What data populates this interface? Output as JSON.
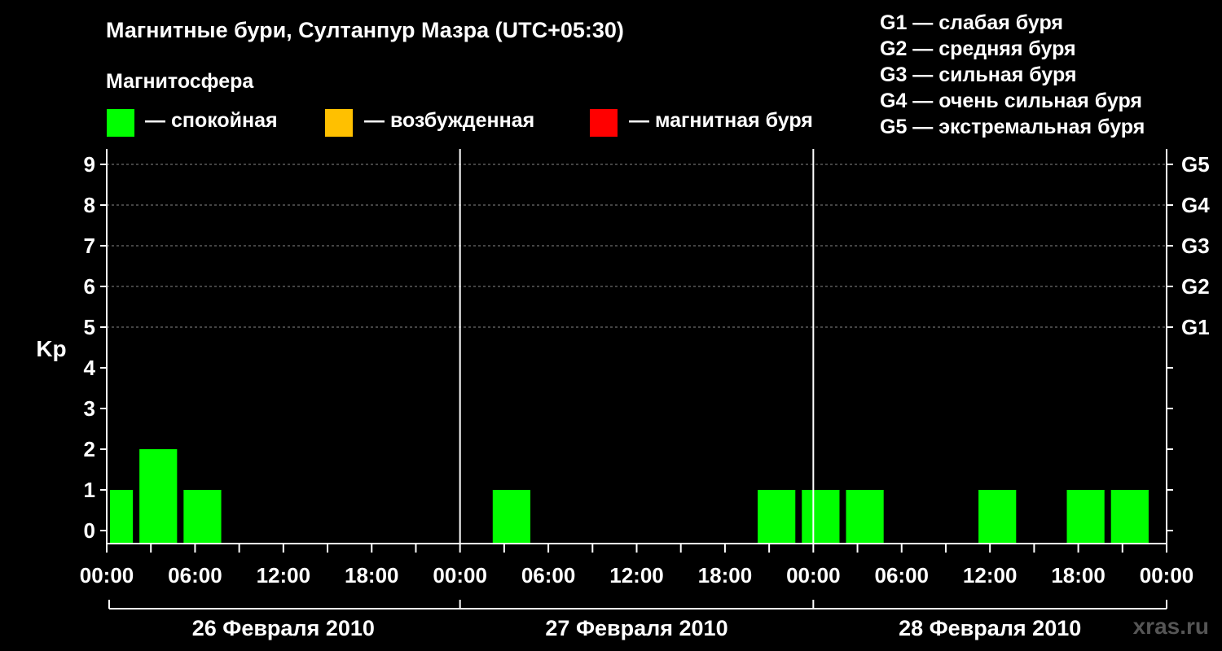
{
  "title": "Магнитные бури, Султанпур Мазра (UTC+05:30)",
  "magnetosphere": {
    "heading": "Магнитосфера",
    "legend": [
      {
        "label": "— спокойная",
        "color": "#00ff00"
      },
      {
        "label": "— возбужденная",
        "color": "#ffc000"
      },
      {
        "label": "— магнитная буря",
        "color": "#ff0000"
      }
    ]
  },
  "storm_scale": [
    "G1 — слабая буря",
    "G2 — средняя буря",
    "G3 — сильная буря",
    "G4 — очень сильная буря",
    "G5 — экстремальная буря"
  ],
  "watermark": "xras.ru",
  "colors": {
    "background": "#000000",
    "quiet": "#00ff00",
    "axis": "#ffffff",
    "grid": "#888888"
  },
  "chart_data": {
    "type": "bar",
    "ylabel": "Kp",
    "ylim": [
      0,
      9
    ],
    "y_ticks": [
      "0",
      "1",
      "2",
      "3",
      "4",
      "5",
      "6",
      "7",
      "8",
      "9"
    ],
    "right_ticks": [
      {
        "kp": 5,
        "label": "G1"
      },
      {
        "kp": 6,
        "label": "G2"
      },
      {
        "kp": 7,
        "label": "G3"
      },
      {
        "kp": 8,
        "label": "G4"
      },
      {
        "kp": 9,
        "label": "G5"
      }
    ],
    "x_tick_labels": [
      "00:00",
      "06:00",
      "12:00",
      "18:00",
      "00:00",
      "06:00",
      "12:00",
      "18:00",
      "00:00",
      "06:00",
      "12:00",
      "18:00",
      "00:00"
    ],
    "days": [
      "26 Февраля 2010",
      "27 Февраля 2010",
      "28 Февраля 2010"
    ],
    "grid": true,
    "bars": [
      {
        "day": "26 Февраля 2010",
        "start": "00:00",
        "end": "02:00",
        "kp": 1,
        "status": "спокойная"
      },
      {
        "day": "26 Февраля 2010",
        "start": "02:00",
        "end": "05:00",
        "kp": 2,
        "status": "спокойная"
      },
      {
        "day": "26 Февраля 2010",
        "start": "05:00",
        "end": "08:00",
        "kp": 1,
        "status": "спокойная"
      },
      {
        "day": "27 Февраля 2010",
        "start": "02:00",
        "end": "05:00",
        "kp": 1,
        "status": "спокойная"
      },
      {
        "day": "27 Февраля 2010",
        "start": "20:00",
        "end": "23:00",
        "kp": 1,
        "status": "спокойная"
      },
      {
        "day": "28 Февраля 2010",
        "start": "23:00",
        "end": "02:00",
        "kp": 1,
        "status": "спокойная"
      },
      {
        "day": "28 Февраля 2010",
        "start": "02:00",
        "end": "05:00",
        "kp": 1,
        "status": "спокойная"
      },
      {
        "day": "28 Февраля 2010",
        "start": "11:00",
        "end": "14:00",
        "kp": 1,
        "status": "спокойная"
      },
      {
        "day": "28 Февраля 2010",
        "start": "17:00",
        "end": "20:00",
        "kp": 1,
        "status": "спокойная"
      },
      {
        "day": "28 Февраля 2010",
        "start": "20:00",
        "end": "23:00",
        "kp": 1,
        "status": "спокойная"
      }
    ]
  }
}
